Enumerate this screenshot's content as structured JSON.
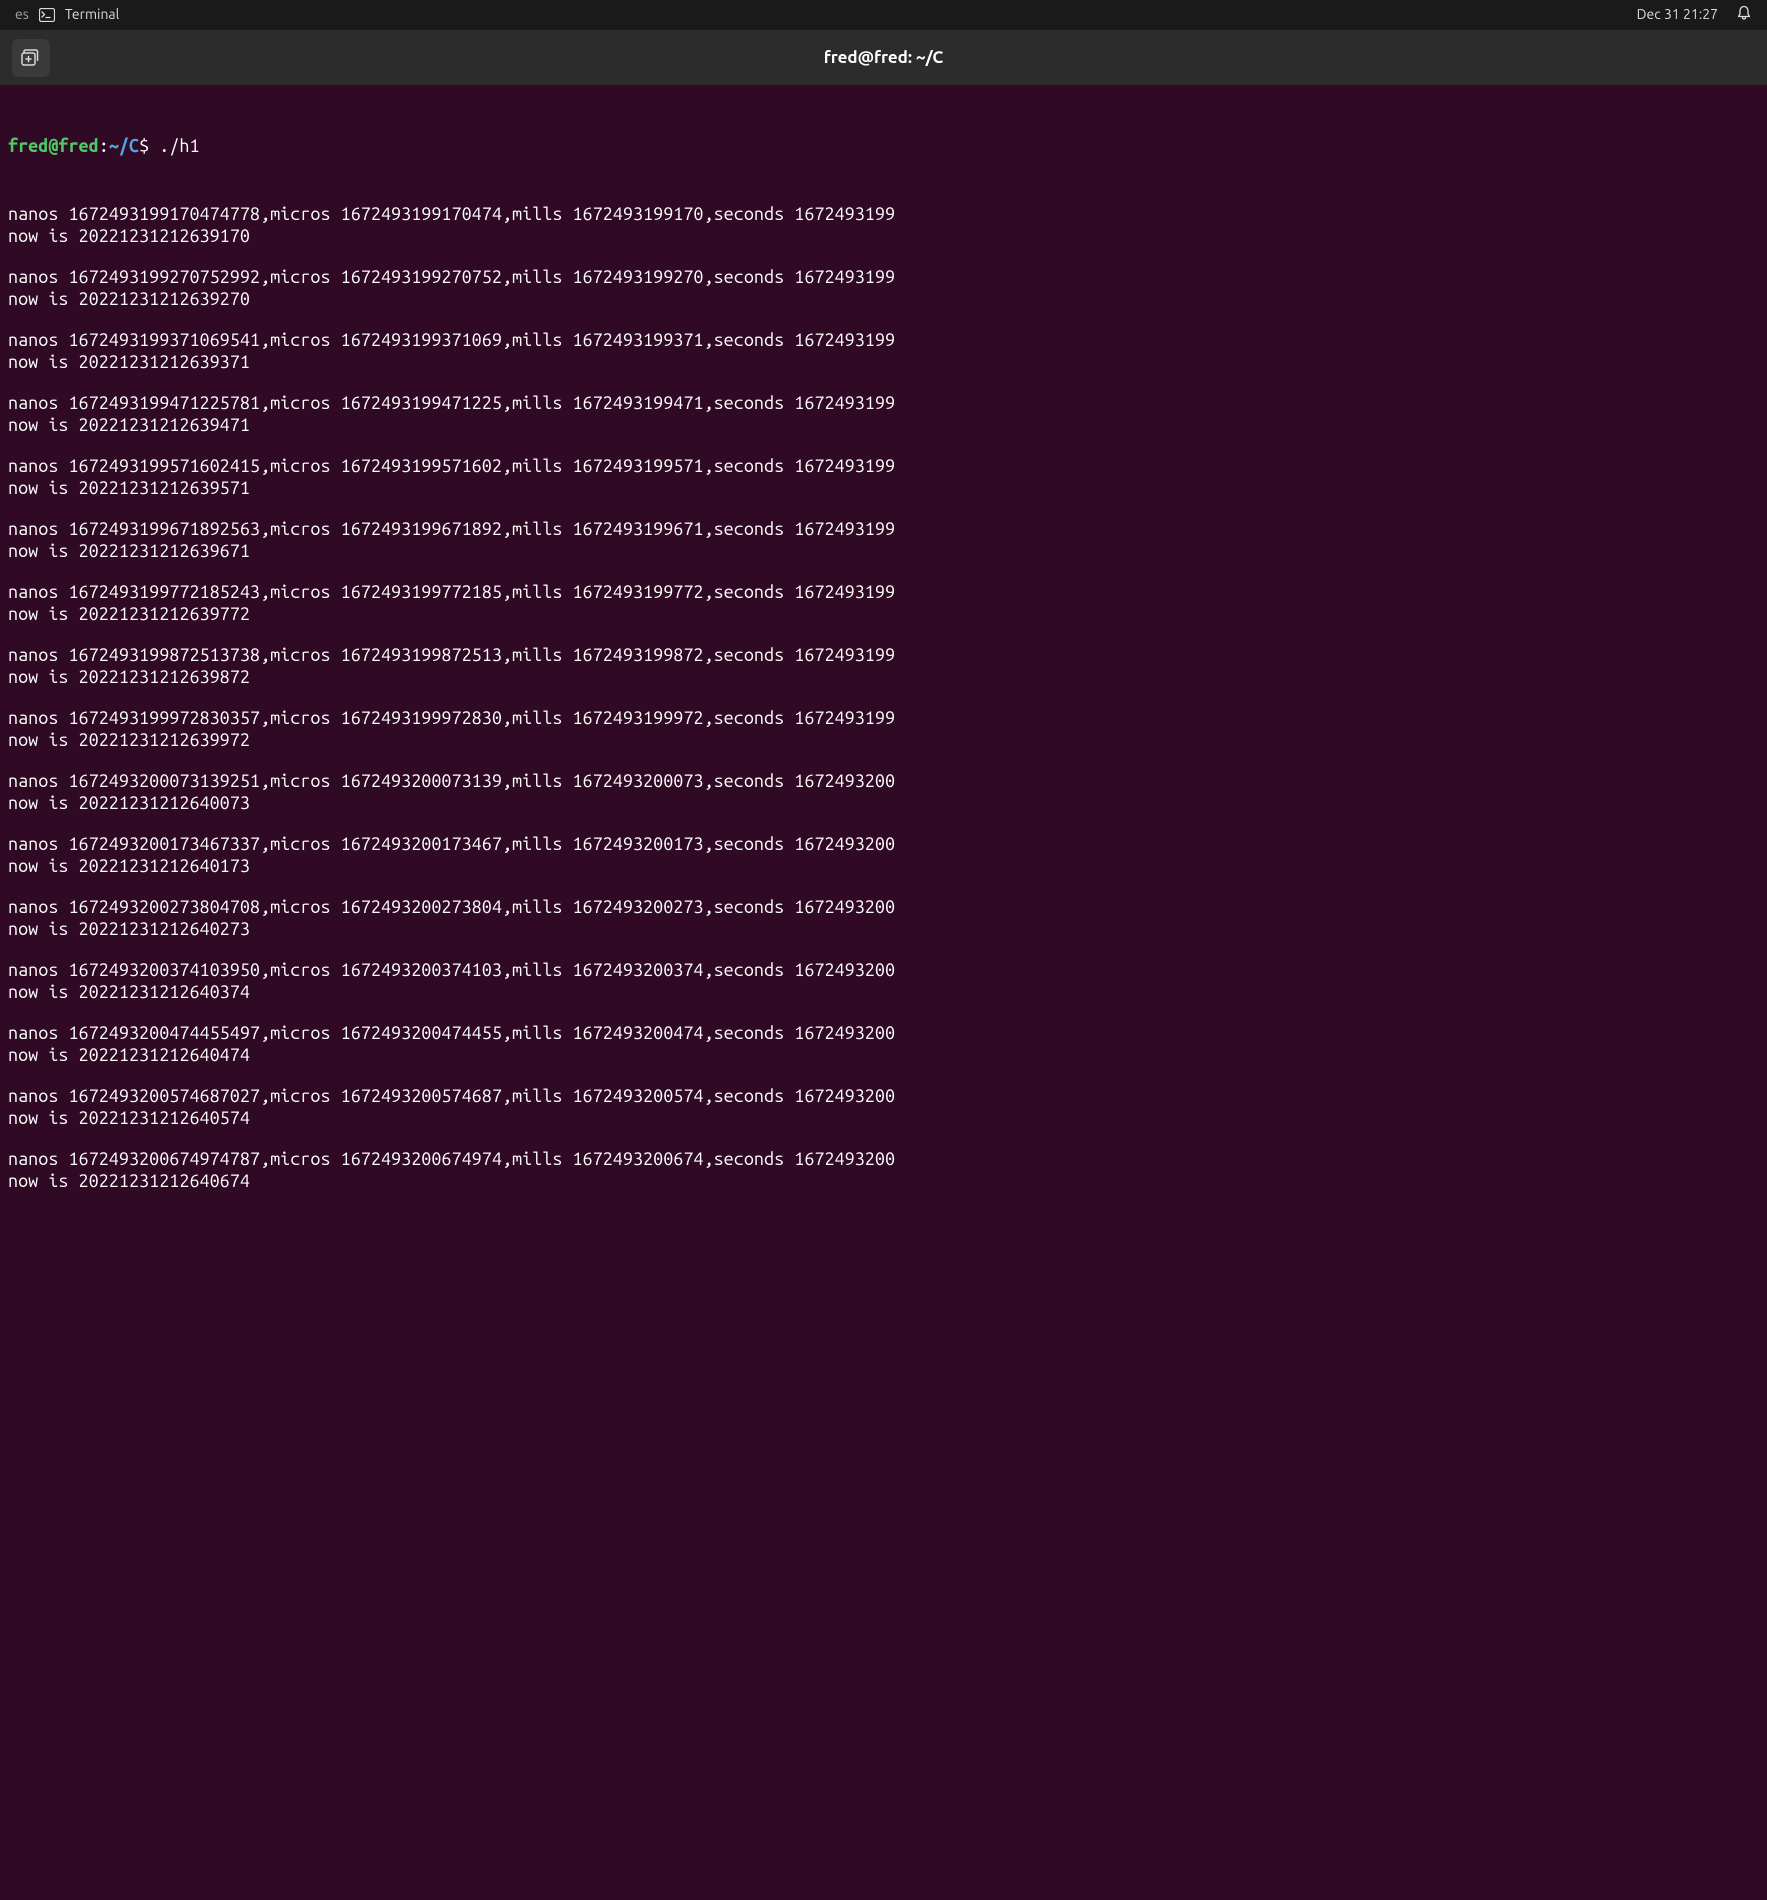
{
  "topbar": {
    "activities": "es",
    "app_name": "Terminal",
    "datetime": "Dec 31  21:27"
  },
  "titlebar": {
    "title": "fred@fred: ~/C"
  },
  "prompt": {
    "user_host": "fred@fred",
    "colon": ":",
    "path": "~/C",
    "dollar": "$",
    "command": "./h1"
  },
  "blocks": [
    {
      "line1": "nanos 1672493199170474778,micros 1672493199170474,mills 1672493199170,seconds 1672493199",
      "line2": "now is 20221231212639170"
    },
    {
      "line1": "nanos 1672493199270752992,micros 1672493199270752,mills 1672493199270,seconds 1672493199",
      "line2": "now is 20221231212639270"
    },
    {
      "line1": "nanos 1672493199371069541,micros 1672493199371069,mills 1672493199371,seconds 1672493199",
      "line2": "now is 20221231212639371"
    },
    {
      "line1": "nanos 1672493199471225781,micros 1672493199471225,mills 1672493199471,seconds 1672493199",
      "line2": "now is 20221231212639471"
    },
    {
      "line1": "nanos 1672493199571602415,micros 1672493199571602,mills 1672493199571,seconds 1672493199",
      "line2": "now is 20221231212639571"
    },
    {
      "line1": "nanos 1672493199671892563,micros 1672493199671892,mills 1672493199671,seconds 1672493199",
      "line2": "now is 20221231212639671"
    },
    {
      "line1": "nanos 1672493199772185243,micros 1672493199772185,mills 1672493199772,seconds 1672493199",
      "line2": "now is 20221231212639772"
    },
    {
      "line1": "nanos 1672493199872513738,micros 1672493199872513,mills 1672493199872,seconds 1672493199",
      "line2": "now is 20221231212639872"
    },
    {
      "line1": "nanos 1672493199972830357,micros 1672493199972830,mills 1672493199972,seconds 1672493199",
      "line2": "now is 20221231212639972"
    },
    {
      "line1": "nanos 1672493200073139251,micros 1672493200073139,mills 1672493200073,seconds 1672493200",
      "line2": "now is 20221231212640073"
    },
    {
      "line1": "nanos 1672493200173467337,micros 1672493200173467,mills 1672493200173,seconds 1672493200",
      "line2": "now is 20221231212640173"
    },
    {
      "line1": "nanos 1672493200273804708,micros 1672493200273804,mills 1672493200273,seconds 1672493200",
      "line2": "now is 20221231212640273"
    },
    {
      "line1": "nanos 1672493200374103950,micros 1672493200374103,mills 1672493200374,seconds 1672493200",
      "line2": "now is 20221231212640374"
    },
    {
      "line1": "nanos 1672493200474455497,micros 1672493200474455,mills 1672493200474,seconds 1672493200",
      "line2": "now is 20221231212640474"
    },
    {
      "line1": "nanos 1672493200574687027,micros 1672493200574687,mills 1672493200574,seconds 1672493200",
      "line2": "now is 20221231212640574"
    },
    {
      "line1": "nanos 1672493200674974787,micros 1672493200674974,mills 1672493200674,seconds 1672493200",
      "line2": "now is 20221231212640674"
    }
  ]
}
